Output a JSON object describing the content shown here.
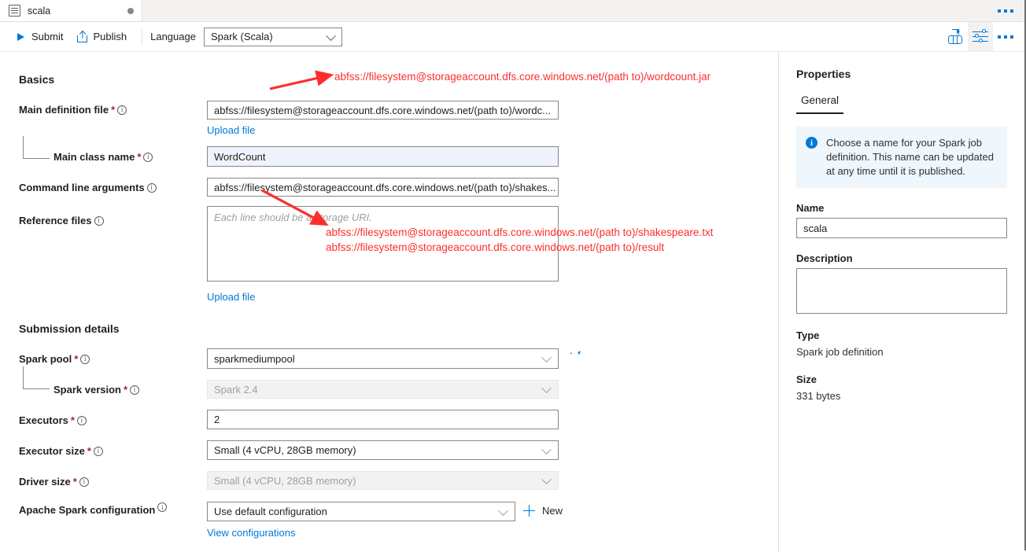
{
  "tab": {
    "label": "scala",
    "icon": "document-lines-icon",
    "modified_dot": true
  },
  "toolbar": {
    "submit_label": "Submit",
    "publish_label": "Publish",
    "language_label": "Language",
    "language_value": "Spark (Scala)",
    "icons": [
      "spark-pool-icon",
      "settings-sliders-icon",
      "more-options-icon"
    ]
  },
  "form": {
    "basics_title": "Basics",
    "main_definition_file": {
      "label": "Main definition file",
      "required": "*",
      "value": "abfss://filesystem@storageaccount.dfs.core.windows.net/(path to)/wordc...",
      "upload_link": "Upload file"
    },
    "main_class_name": {
      "label": "Main class name",
      "required": "*",
      "value": "WordCount"
    },
    "command_line_arguments": {
      "label": "Command line arguments",
      "value": "abfss://filesystem@storageaccount.dfs.core.windows.net/(path to)/shakes..."
    },
    "reference_files": {
      "label": "Reference files",
      "placeholder": "Each line should be a storage URI.",
      "value": "",
      "upload_link": "Upload file"
    },
    "submission_title": "Submission details",
    "spark_pool": {
      "label": "Spark pool",
      "required": "*",
      "value": "sparkmediumpool",
      "refresh_icon": "refresh-icon"
    },
    "spark_version": {
      "label": "Spark version",
      "required": "*",
      "value": "Spark 2.4",
      "disabled": true
    },
    "executors": {
      "label": "Executors",
      "required": "*",
      "value": "2"
    },
    "executor_size": {
      "label": "Executor size",
      "required": "*",
      "value": "Small (4 vCPU, 28GB memory)"
    },
    "driver_size": {
      "label": "Driver size",
      "required": "*",
      "value": "Small (4 vCPU, 28GB memory)",
      "disabled": true
    },
    "apache_spark_configuration": {
      "label": "Apache Spark configuration",
      "value": "Use default configuration",
      "new_label": "New",
      "view_link": "View configurations"
    }
  },
  "annotations": {
    "main_file_uri": "abfss://filesystem@storageaccount.dfs.core.windows.net/(path to)/wordcount.jar",
    "ref_uri_1": "abfss://filesystem@storageaccount.dfs.core.windows.net/(path to)/shakespeare.txt",
    "ref_uri_2": "abfss://filesystem@storageaccount.dfs.core.windows.net/(path to)/result",
    "color": "#ff2d2d"
  },
  "properties": {
    "title": "Properties",
    "tab_general": "General",
    "info_text": "Choose a name for your Spark job definition. This name can be updated at any time until it is published.",
    "name_label": "Name",
    "name_value": "scala",
    "description_label": "Description",
    "description_value": "",
    "type_label": "Type",
    "type_value": "Spark job definition",
    "size_label": "Size",
    "size_value": "331 bytes"
  },
  "colors": {
    "accent": "#0078d4",
    "required_red": "#a4262c",
    "info_bg": "#eff6fc",
    "annotation_red": "#ff2d2d"
  }
}
